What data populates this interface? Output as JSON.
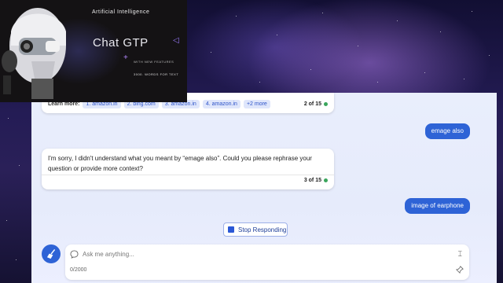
{
  "banner": {
    "subtitle": "Artificial Intelligence",
    "title": "Chat GTP",
    "tagline": "WITH NEW FEATURES",
    "words": "3000. WORDS FOR TEXT"
  },
  "chat": {
    "card1": {
      "learn_label": "Learn more:",
      "links": [
        "1. amazon.in",
        "2. bing.com",
        "3. amazon.in",
        "4. amazon.in",
        "+2 more"
      ],
      "count": "2 of 15"
    },
    "user_message_1": "emage also",
    "card2": {
      "text": "I'm sorry, I didn't understand what you meant by “emage also”. Could you please rephrase your question or provide more context?",
      "count": "3 of 15"
    },
    "user_message_2": "image of earphone",
    "stop_button": "Stop Responding",
    "input": {
      "placeholder": "Ask me anything...",
      "counter": "0/2000"
    }
  },
  "colors": {
    "accent": "#2e63d6",
    "status_dot": "#3aa55c"
  }
}
